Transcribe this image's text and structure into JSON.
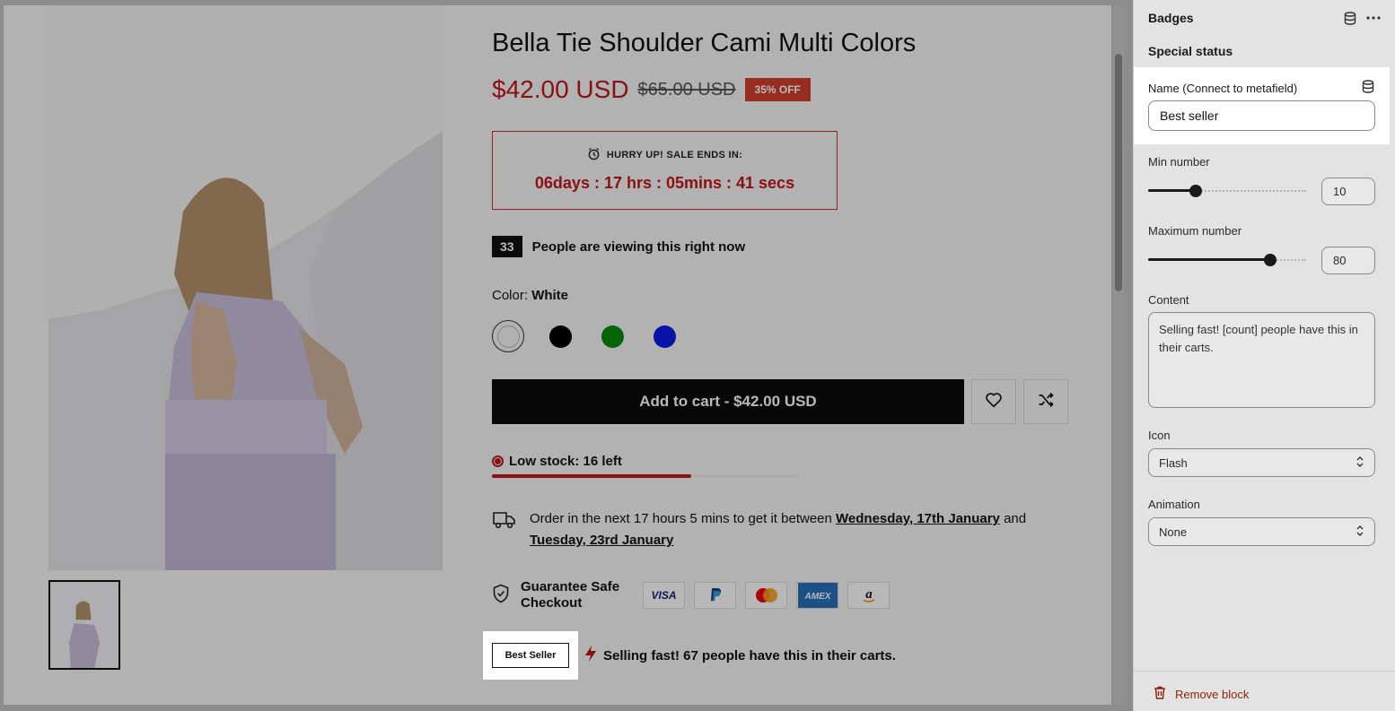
{
  "product": {
    "title": "Bella Tie Shoulder Cami Multi Colors",
    "price": "$42.00 USD",
    "compare_price": "$65.00 USD",
    "discount": "35% OFF",
    "countdown_label": "HURRY UP! SALE ENDS IN:",
    "countdown_time": "06days : 17 hrs : 05mins : 41 secs",
    "viewer_count": "33",
    "viewer_text": "People are viewing this right now",
    "color_label": "Color:",
    "color_value": "White",
    "swatches": [
      {
        "name": "White",
        "color": "#f5f5f5"
      },
      {
        "name": "Black",
        "color": "#000000"
      },
      {
        "name": "Green",
        "color": "#0a8a0a"
      },
      {
        "name": "Blue",
        "color": "#0a1ae8"
      }
    ],
    "add_to_cart": "Add to cart - $42.00 USD",
    "stock_text": "Low stock: 16 left",
    "stock_fraction": 0.65,
    "delivery_prefix": "Order in the next 17 hours 5 mins to get it between",
    "delivery_date1": "Wednesday, 17th January",
    "delivery_and": "and",
    "delivery_date2": "Tuesday, 23rd January",
    "checkout_label": "Guarantee Safe Checkout",
    "payments": [
      "VISA",
      "PayPal",
      "Mastercard",
      "AMEX",
      "Amazon"
    ],
    "badge": "Best Seller",
    "selling_text": "Selling fast! 67 people have this in their carts."
  },
  "sidebar": {
    "title": "Badges",
    "section": "Special status",
    "name_label": "Name (Connect to metafield)",
    "name_value": "Best seller",
    "min_label": "Min number",
    "min_value": "10",
    "min_fraction": 0.3,
    "max_label": "Maximum number",
    "max_value": "80",
    "max_fraction": 0.77,
    "content_label": "Content",
    "content_value": "Selling fast! [count] people have this in their carts.",
    "icon_label": "Icon",
    "icon_value": "Flash",
    "animation_label": "Animation",
    "animation_value": "None",
    "remove_label": "Remove block"
  },
  "colors": {
    "accent_red": "#c0171c",
    "discount_bg": "#d13f2b",
    "remove_red": "#8e1f0b"
  }
}
